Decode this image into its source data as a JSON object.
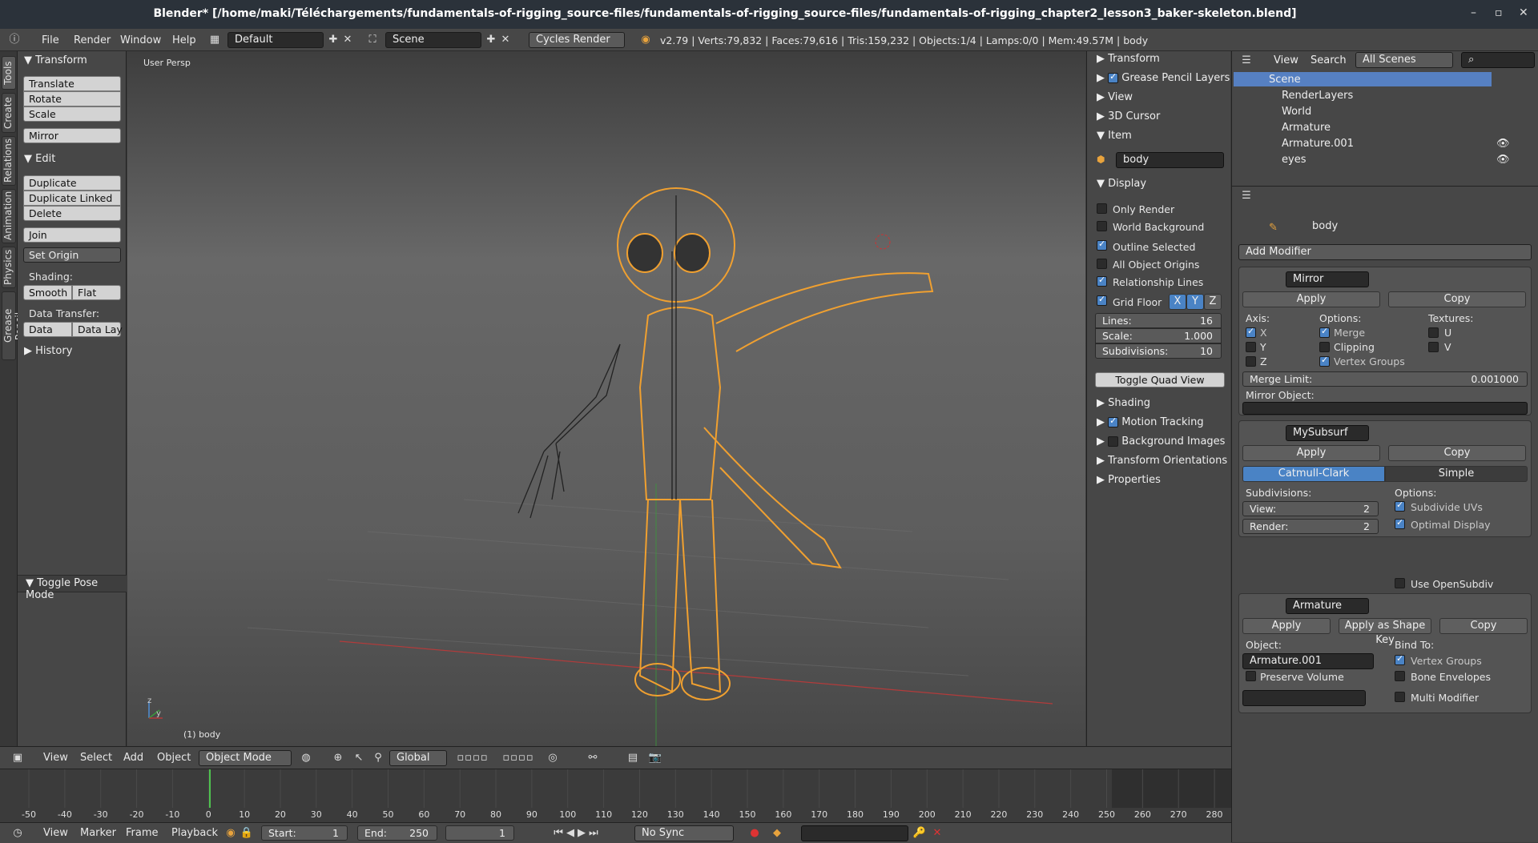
{
  "window": {
    "title": "Blender* [/home/maki/Téléchargements/fundamentals-of-rigging_source-files/fundamentals-of-rigging_source-files/fundamentals-of-rigging_chapter2_lesson3_baker-skeleton.blend]",
    "minimize": "–",
    "maximize": "▫",
    "close": "✕"
  },
  "infobar": {
    "menus": [
      "File",
      "Render",
      "Window",
      "Help"
    ],
    "layout": "Default",
    "scene": "Scene",
    "engine": "Cycles Render",
    "stats": "v2.79 | Verts:79,832 | Faces:79,616 | Tris:159,232 | Objects:1/4 | Lamps:0/0 | Mem:49.57M | body"
  },
  "tabs": [
    "Tools",
    "Create",
    "Relations",
    "Animation",
    "Physics",
    "Grease Pencil"
  ],
  "shelf": {
    "transform_header": "Transform",
    "translate": "Translate",
    "rotate": "Rotate",
    "scale": "Scale",
    "mirror": "Mirror",
    "edit_header": "Edit",
    "duplicate": "Duplicate",
    "duplicate_linked": "Duplicate Linked",
    "delete": "Delete",
    "join": "Join",
    "set_origin": "Set Origin",
    "shading_label": "Shading:",
    "smooth": "Smooth",
    "flat": "Flat",
    "data_transfer_label": "Data Transfer:",
    "data": "Data",
    "data_lay": "Data Lay",
    "history": "History",
    "toggle_pose": "Toggle Pose Mode"
  },
  "viewport": {
    "persp": "User Persp",
    "object_label": "(1) body",
    "axis_z": "z",
    "axis_y": "y"
  },
  "npanel": {
    "transform": "Transform",
    "grease": "Grease Pencil Layers",
    "view": "View",
    "cursor": "3D Cursor",
    "item": "Item",
    "item_name": "body",
    "display": "Display",
    "only_render": "Only Render",
    "world_bg": "World Background",
    "outline": "Outline Selected",
    "all_origins": "All Object Origins",
    "rel_lines": "Relationship Lines",
    "grid_floor": "Grid Floor",
    "gx": "X",
    "gy": "Y",
    "gz": "Z",
    "lines_label": "Lines:",
    "lines_val": "16",
    "scale_label": "Scale:",
    "scale_val": "1.000",
    "subdiv_label": "Subdivisions:",
    "subdiv_val": "10",
    "quad": "Toggle Quad View",
    "shading": "Shading",
    "motion": "Motion Tracking",
    "bgimg": "Background Images",
    "orient": "Transform Orientations",
    "properties": "Properties"
  },
  "outliner": {
    "view": "View",
    "search": "Search",
    "filter": "All Scenes",
    "items": [
      "Scene",
      "RenderLayers",
      "World",
      "Armature",
      "Armature.001",
      "eyes"
    ]
  },
  "props": {
    "crumb": "body",
    "add_modifier": "Add Modifier",
    "mirror": {
      "name": "Mirror",
      "apply": "Apply",
      "copy": "Copy",
      "axis": "Axis:",
      "options": "Options:",
      "textures": "Textures:",
      "x": "X",
      "y": "Y",
      "z": "Z",
      "merge": "Merge",
      "clipping": "Clipping",
      "vgroups": "Vertex Groups",
      "u": "U",
      "v": "V",
      "merge_limit": "Merge Limit:",
      "merge_val": "0.001000",
      "mirror_obj": "Mirror Object:"
    },
    "subsurf": {
      "name": "MySubsurf",
      "apply": "Apply",
      "copy": "Copy",
      "catmull": "Catmull-Clark",
      "simple": "Simple",
      "subdivisions": "Subdivisions:",
      "options": "Options:",
      "view": "View:",
      "view_val": "2",
      "render": "Render:",
      "render_val": "2",
      "subuv": "Subdivide UVs",
      "optimal": "Optimal Display",
      "opensubdiv": "Use OpenSubdiv"
    },
    "armature": {
      "name": "Armature",
      "apply": "Apply",
      "apply_shape": "Apply as Shape Key",
      "copy": "Copy",
      "object": "Object:",
      "object_val": "Armature.001",
      "bind": "Bind To:",
      "vgroups": "Vertex Groups",
      "preserve": "Preserve Volume",
      "envelopes": "Bone Envelopes",
      "multi": "Multi Modifier"
    }
  },
  "vhead": {
    "menus": [
      "View",
      "Select",
      "Add",
      "Object"
    ],
    "mode": "Object Mode",
    "orient": "Global"
  },
  "timeline": {
    "ticks": [
      "-50",
      "-40",
      "-30",
      "-20",
      "-10",
      "0",
      "10",
      "20",
      "30",
      "40",
      "50",
      "60",
      "70",
      "80",
      "90",
      "100",
      "110",
      "120",
      "130",
      "140",
      "150",
      "160",
      "170",
      "180",
      "190",
      "200",
      "210",
      "220",
      "230",
      "240",
      "250",
      "260",
      "270",
      "280"
    ]
  },
  "tlhead": {
    "menus": [
      "View",
      "Marker",
      "Frame",
      "Playback"
    ],
    "start": "Start:",
    "start_val": "1",
    "end": "End:",
    "end_val": "250",
    "current": "1",
    "sync": "No Sync"
  }
}
